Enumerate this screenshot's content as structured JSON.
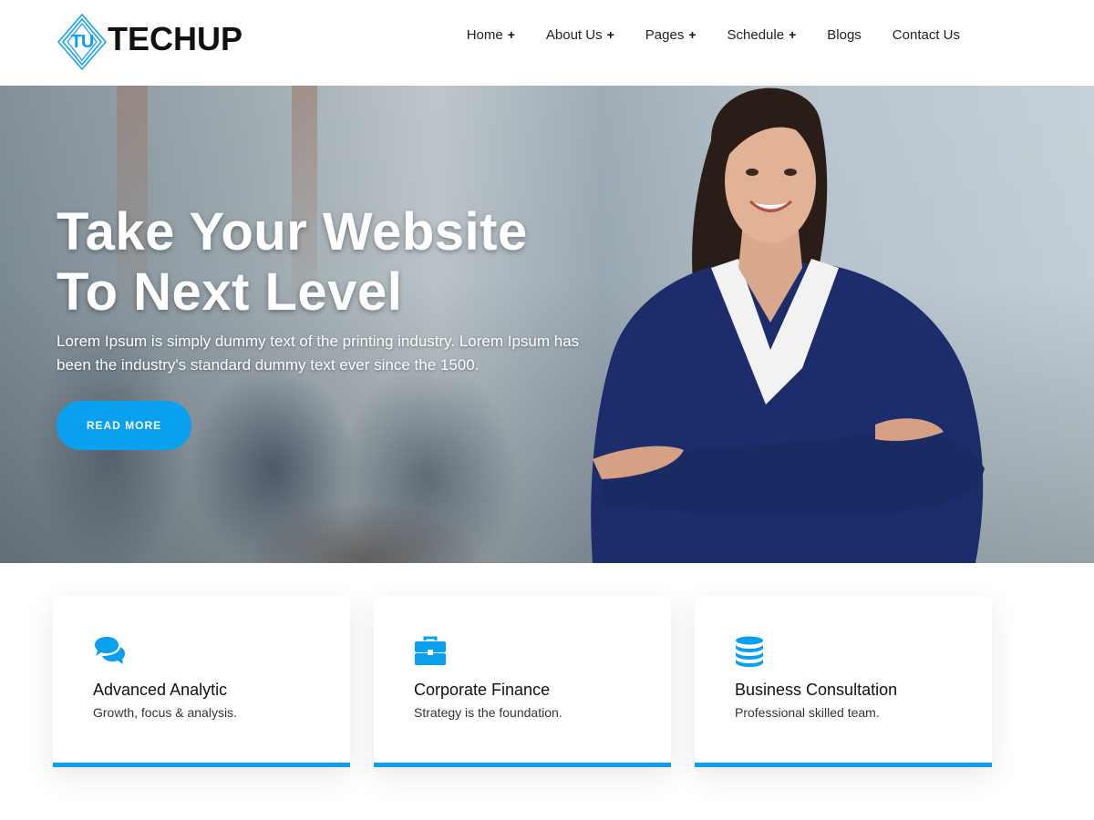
{
  "brand": {
    "initials": "TU",
    "name": "TECHUP",
    "accent_color": "#0aa0f0"
  },
  "nav": {
    "items": [
      {
        "label": "Home",
        "has_submenu": true,
        "submenu_indicator": "+"
      },
      {
        "label": "About Us",
        "has_submenu": true,
        "submenu_indicator": "+"
      },
      {
        "label": "Pages",
        "has_submenu": true,
        "submenu_indicator": "+"
      },
      {
        "label": "Schedule",
        "has_submenu": true,
        "submenu_indicator": "+"
      },
      {
        "label": "Blogs",
        "has_submenu": false
      },
      {
        "label": "Contact Us",
        "has_submenu": false
      }
    ]
  },
  "hero": {
    "title_line1": "Take Your Website",
    "title_line2": "To Next Level",
    "description": "Lorem Ipsum is simply dummy text of the printing industry. Lorem Ipsum has been the industry's standard dummy text ever since the 1500.",
    "button_label": "READ MORE"
  },
  "features": [
    {
      "icon": "chat-bubbles-icon",
      "title": "Advanced Analytic",
      "subtitle": "Growth, focus & analysis."
    },
    {
      "icon": "briefcase-icon",
      "title": "Corporate Finance",
      "subtitle": "Strategy is the foundation."
    },
    {
      "icon": "database-icon",
      "title": "Business Consultation",
      "subtitle": "Professional skilled team."
    }
  ]
}
